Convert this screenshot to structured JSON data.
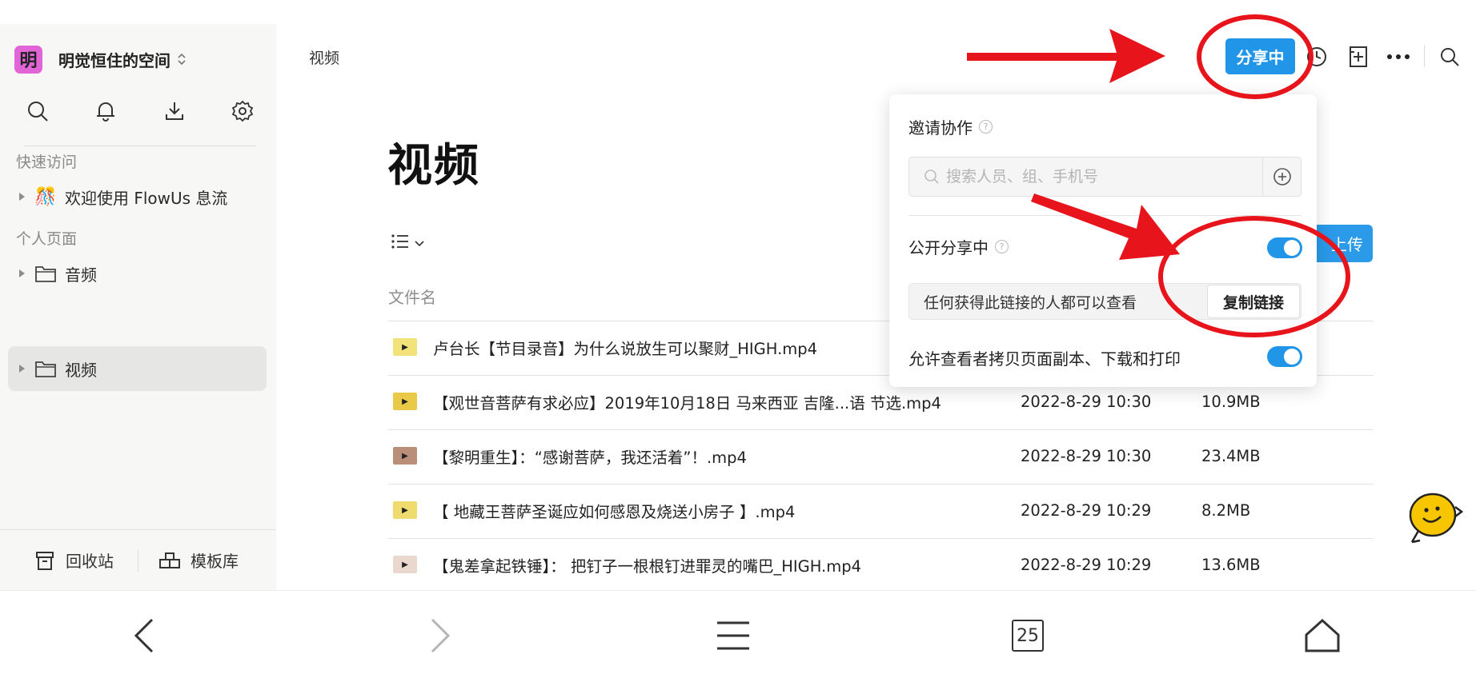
{
  "workspace": {
    "avatar_char": "明",
    "avatar_color": "#e265d8",
    "name": "明觉恒住的空间"
  },
  "sidebar": {
    "tool_icons": [
      "search-icon",
      "bell-icon",
      "download-icon",
      "gear-icon"
    ],
    "quick_access_label": "快速访问",
    "quick_items": [
      {
        "icon": "party-popper-icon",
        "emoji": "🎊",
        "label": "欢迎使用 FlowUs 息流"
      }
    ],
    "personal_label": "个人页面",
    "personal_items": [
      {
        "icon": "folder-icon",
        "label": "音频",
        "active": false
      },
      {
        "icon": "folder-icon",
        "label": "视频",
        "active": true
      }
    ],
    "trash_label": "回收站",
    "templates_label": "模板库"
  },
  "breadcrumb": "视频",
  "page": {
    "title": "视频",
    "column_name": "文件名",
    "upload_label": "上传",
    "files": [
      {
        "name": "卢台长【节目录音】为什么说放生可以聚财_HIGH.mp4",
        "date": "",
        "size": "",
        "thumb_color": "#f3e27a"
      },
      {
        "name": "【观世音菩萨有求必应】2019年10月18日 马来西亚 吉隆...语 节选.mp4",
        "date": "2022-8-29 10:30",
        "size": "10.9MB",
        "thumb_color": "#e9c948"
      },
      {
        "name": "【黎明重生】：“感谢菩萨，我还活着”！.mp4",
        "date": "2022-8-29 10:30",
        "size": "23.4MB",
        "thumb_color": "#b98f7a"
      },
      {
        "name": "【 地藏王菩萨圣诞应如何感恩及烧送小房子 】.mp4",
        "date": "2022-8-29 10:29",
        "size": "8.2MB",
        "thumb_color": "#f0dc6e"
      },
      {
        "name": "【鬼差拿起铁锤】： 把钉子一根根钉进罪灵的嘴巴_HIGH.mp4",
        "date": "2022-8-29 10:29",
        "size": "13.6MB",
        "thumb_color": "#ead8cf"
      }
    ]
  },
  "topbar": {
    "share_label": "分享中",
    "share_color": "#2196e8",
    "icons": [
      "clock-icon",
      "add-page-icon",
      "more-icon",
      "search-icon"
    ]
  },
  "share_popover": {
    "invite_label": "邀请协作",
    "invite_placeholder": "搜索人员、组、手机号",
    "public_label": "公开分享中",
    "public_enabled": true,
    "link_text": "任何获得此链接的人都可以查看",
    "copy_label": "复制链接",
    "allow_label": "允许查看者拷贝页面副本、下载和打印",
    "allow_enabled": true
  },
  "annotation_color": "#e8141c",
  "navbar": {
    "tab_count": "25",
    "buttons": [
      "back-icon",
      "forward-icon",
      "menu-icon",
      "tabs-icon",
      "home-icon"
    ]
  }
}
